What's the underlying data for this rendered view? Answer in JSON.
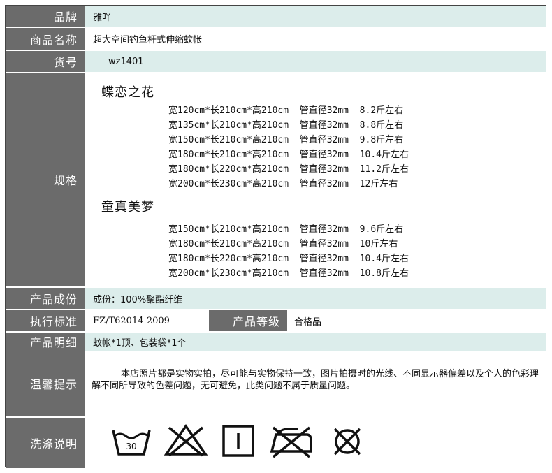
{
  "rows": {
    "brand": {
      "label": "品牌",
      "value": "雅吖"
    },
    "name": {
      "label": "商品名称",
      "value": "超大空间钓鱼杆式伸缩蚊帐"
    },
    "sku": {
      "label": "货号",
      "value": "wz1401"
    },
    "spec": {
      "label": "规格",
      "groups": [
        {
          "title": "蝶恋之花",
          "lines": [
            "宽120cm*长210cm*高210cm  管直径32mm  8.2斤左右",
            "宽135cm*长210cm*高210cm  管直径32mm  8.8斤左右",
            "宽150cm*长210cm*高210cm  管直径32mm  9.8斤左右",
            "宽180cm*长210cm*高210cm  管直径32mm  10.4斤左右",
            "宽180cm*长220cm*高210cm  管直径32mm  11.2斤左右",
            "宽200cm*长230cm*高210cm  管直径32mm  12斤左右"
          ]
        },
        {
          "title": "童真美梦",
          "lines": [
            "宽150cm*长210cm*高210cm  管直径32mm  9.6斤左右",
            "宽180cm*长210cm*高210cm  管直径32mm  10斤左右",
            "宽180cm*长220cm*高210cm  管直径32mm  10.4斤左右",
            "宽200cm*长230cm*高210cm  管直径32mm  10.8斤左右"
          ]
        }
      ]
    },
    "composition": {
      "label": "产品成份",
      "value": "成份：100%聚酯纤维"
    },
    "standard": {
      "label": "执行标准",
      "value": "FZ/T62014-2009",
      "grade_label": "产品等级",
      "grade_value": "合格品"
    },
    "contents": {
      "label": "产品明细",
      "value": "蚊帐*1顶、包装袋*1个"
    },
    "notice": {
      "label": "温馨提示",
      "value": "本店照片都是实物实拍，尽可能与实物保持一致，图片拍摄时的光线、不同显示器偏差以及个人的色彩理解不同所导致的色差问题，无可避免，此类问题不属于质量问题。"
    },
    "wash": {
      "label": "洗涤说明",
      "icons": [
        {
          "name": "wash-30-icon",
          "text": "30"
        },
        {
          "name": "no-bleach-icon"
        },
        {
          "name": "tumble-dry-icon"
        },
        {
          "name": "no-iron-icon"
        },
        {
          "name": "no-dry-clean-icon"
        }
      ]
    }
  },
  "colors": {
    "label_bg": "#6b6b6b",
    "value_bg": "#dcedeb",
    "border": "#444444"
  }
}
